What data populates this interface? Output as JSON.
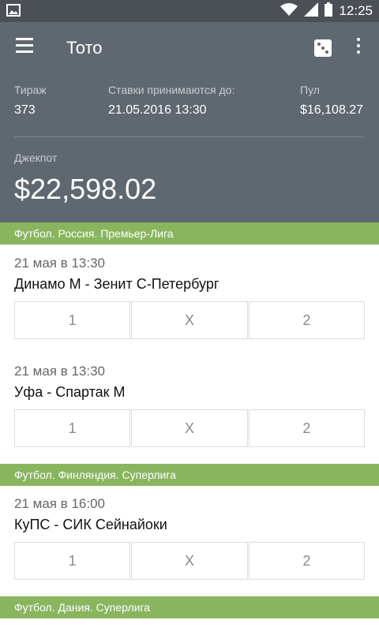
{
  "status_bar": {
    "time": "12:25",
    "icons": [
      "image-icon",
      "wifi-icon",
      "signal-icon",
      "battery-icon"
    ]
  },
  "toolbar": {
    "title": "Тото",
    "icons": [
      "menu-icon",
      "dice-icon",
      "more-vert-icon"
    ]
  },
  "draw_info": {
    "draw_label": "Тираж",
    "draw_value": "373",
    "deadline_label": "Ставки принимаются до:",
    "deadline_value": "21.05.2016 13:30",
    "pool_label": "Пул",
    "pool_value": "$16,108.27",
    "jackpot_label": "Джекпот",
    "jackpot_value": "$22,598.02"
  },
  "leagues": [
    {
      "name": "Футбол. Россия. Премьер-Лига",
      "matches": [
        {
          "date": "21 мая в 13:30",
          "teams": "Динамо М - Зенит С-Петербург",
          "options": [
            "1",
            "X",
            "2"
          ]
        },
        {
          "date": "21 мая в 13:30",
          "teams": "Уфа - Спартак М",
          "options": [
            "1",
            "X",
            "2"
          ]
        }
      ]
    },
    {
      "name": "Футбол. Финляндия. Суперлига",
      "matches": [
        {
          "date": "21 мая в 16:00",
          "teams": "КуПС - СИК Сейнайоки",
          "options": [
            "1",
            "X",
            "2"
          ]
        }
      ]
    },
    {
      "name": "Футбол. Дания. Суперлига",
      "matches": []
    }
  ],
  "colors": {
    "status_bar": "#4a5055",
    "header": "#5f6870",
    "league_bar": "#8ab55f"
  }
}
